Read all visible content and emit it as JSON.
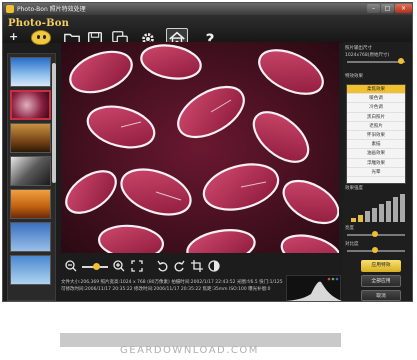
{
  "window": {
    "title": "Photo-Bon 照片特效处理",
    "min_label": "–",
    "max_label": "□",
    "close_label": "×"
  },
  "header": {
    "logo_text": "Photo-Bon",
    "add_label": "+"
  },
  "toolbar": {
    "icons": [
      "open-folder-icon",
      "save-icon",
      "save-all-icon",
      "settings-icon",
      "home-icon",
      "help-icon"
    ]
  },
  "bottombar": {
    "icons": [
      "zoom-out-icon",
      "zoom-in-icon",
      "fit-screen-icon",
      "rotate-left-icon",
      "rotate-right-icon",
      "crop-icon",
      "contrast-icon"
    ],
    "zoom_level": 0.55
  },
  "info": {
    "line1": "文件大小:206,369  照片宽高:1024 x 768 (80万像素)  拍摄时间:2002/1/17 22:43:52  光圈:f/6.5  快门:1/125",
    "line2": "可修改时间:2006/11/17 20:35:22  修改时间:2006/11/17 20:35:22  焦距:35mm  ISO:100  曝光补偿:0"
  },
  "right_panel": {
    "size_label": "照片输出尺寸",
    "size_value": "1024x768(原始尺寸)",
    "effects_label": "特效效果",
    "effects": [
      "柔焦效果",
      "暖色调",
      "冷色调",
      "黑白照片",
      "老照片",
      "怀旧效果",
      "素描",
      "油画效果",
      "浮雕效果",
      "光晕"
    ],
    "selected_effect": 0,
    "strength_label": "效果强度",
    "brightness_label": "亮度",
    "contrast_label": "对比度",
    "apply_button": "应用特效",
    "apply_all_button": "全部应用",
    "cancel_button": "取消"
  },
  "watermark": "GEARDOWNLOAD.COM",
  "colors": {
    "accent": "#f0c030",
    "selection": "#c83040",
    "background": "#1c1c1c"
  }
}
